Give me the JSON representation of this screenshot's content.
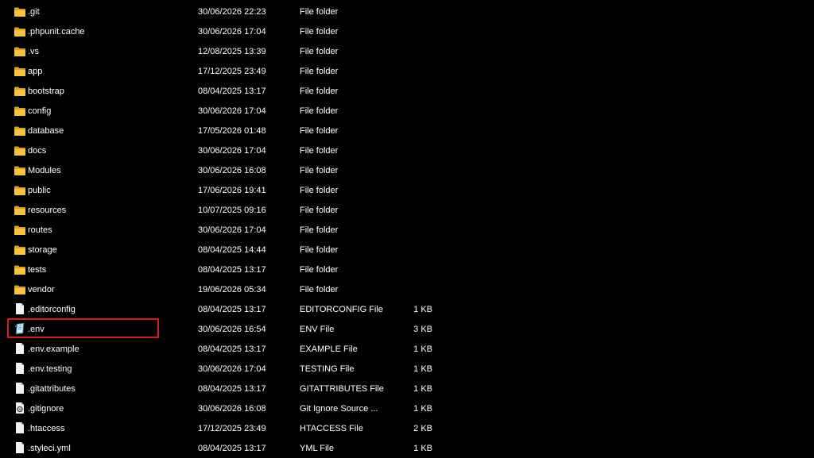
{
  "highlight": {
    "color": "#d11f1f",
    "target": ".env"
  },
  "colors": {
    "folder": "#f7c343",
    "folder_dark": "#d9a227",
    "file_page": "#f2f2f2",
    "file_fold": "#b8b8b8"
  },
  "files": [
    {
      "name": ".git",
      "date": "30/06/2026 22:23",
      "type": "File folder",
      "size": "",
      "icon": "folder-icon"
    },
    {
      "name": ".phpunit.cache",
      "date": "30/06/2026 17:04",
      "type": "File folder",
      "size": "",
      "icon": "folder-icon"
    },
    {
      "name": ".vs",
      "date": "12/08/2025 13:39",
      "type": "File folder",
      "size": "",
      "icon": "folder-icon"
    },
    {
      "name": "app",
      "date": "17/12/2025 23:49",
      "type": "File folder",
      "size": "",
      "icon": "folder-icon"
    },
    {
      "name": "bootstrap",
      "date": "08/04/2025 13:17",
      "type": "File folder",
      "size": "",
      "icon": "folder-icon"
    },
    {
      "name": "config",
      "date": "30/06/2026 17:04",
      "type": "File folder",
      "size": "",
      "icon": "folder-icon"
    },
    {
      "name": "database",
      "date": "17/05/2026 01:48",
      "type": "File folder",
      "size": "",
      "icon": "folder-icon"
    },
    {
      "name": "docs",
      "date": "30/06/2026 17:04",
      "type": "File folder",
      "size": "",
      "icon": "folder-icon"
    },
    {
      "name": "Modules",
      "date": "30/06/2026 16:08",
      "type": "File folder",
      "size": "",
      "icon": "folder-icon"
    },
    {
      "name": "public",
      "date": "17/06/2026 19:41",
      "type": "File folder",
      "size": "",
      "icon": "folder-icon"
    },
    {
      "name": "resources",
      "date": "10/07/2025 09:16",
      "type": "File folder",
      "size": "",
      "icon": "folder-icon"
    },
    {
      "name": "routes",
      "date": "30/06/2026 17:04",
      "type": "File folder",
      "size": "",
      "icon": "folder-icon"
    },
    {
      "name": "storage",
      "date": "08/04/2025 14:44",
      "type": "File folder",
      "size": "",
      "icon": "folder-icon"
    },
    {
      "name": "tests",
      "date": "08/04/2025 13:17",
      "type": "File folder",
      "size": "",
      "icon": "folder-icon"
    },
    {
      "name": "vendor",
      "date": "19/06/2026 05:34",
      "type": "File folder",
      "size": "",
      "icon": "folder-icon"
    },
    {
      "name": ".editorconfig",
      "date": "08/04/2025 13:17",
      "type": "EDITORCONFIG File",
      "size": "1 KB",
      "icon": "file-icon"
    },
    {
      "name": ".env",
      "date": "30/06/2026 16:54",
      "type": "ENV File",
      "size": "3 KB",
      "icon": "notepad-icon"
    },
    {
      "name": ".env.example",
      "date": "08/04/2025 13:17",
      "type": "EXAMPLE File",
      "size": "1 KB",
      "icon": "file-icon"
    },
    {
      "name": ".env.testing",
      "date": "30/06/2026 17:04",
      "type": "TESTING File",
      "size": "1 KB",
      "icon": "file-icon"
    },
    {
      "name": ".gitattributes",
      "date": "08/04/2025 13:17",
      "type": "GITATTRIBUTES File",
      "size": "1 KB",
      "icon": "file-icon"
    },
    {
      "name": ".gitignore",
      "date": "30/06/2026 16:08",
      "type": "Git Ignore Source ...",
      "size": "1 KB",
      "icon": "gear-file-icon"
    },
    {
      "name": ".htaccess",
      "date": "17/12/2025 23:49",
      "type": "HTACCESS File",
      "size": "2 KB",
      "icon": "file-icon"
    },
    {
      "name": ".styleci.yml",
      "date": "08/04/2025 13:17",
      "type": "YML File",
      "size": "1 KB",
      "icon": "file-icon"
    }
  ]
}
